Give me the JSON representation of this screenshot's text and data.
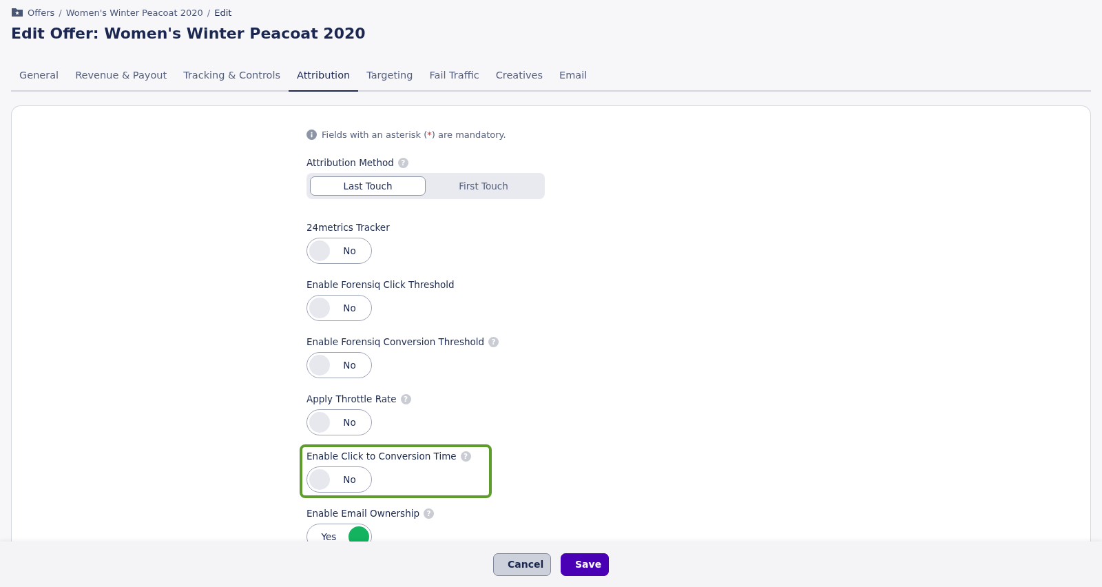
{
  "breadcrumb": {
    "separator": "/",
    "items": [
      "Offers",
      "Women's Winter Peacoat 2020",
      "Edit"
    ]
  },
  "title": "Edit Offer: Women's Winter Peacoat 2020",
  "tabs": [
    {
      "label": "General",
      "selected": false
    },
    {
      "label": "Revenue & Payout",
      "selected": false
    },
    {
      "label": "Tracking & Controls",
      "selected": false
    },
    {
      "label": "Attribution",
      "selected": true
    },
    {
      "label": "Targeting",
      "selected": false
    },
    {
      "label": "Fail Traffic",
      "selected": false
    },
    {
      "label": "Creatives",
      "selected": false
    },
    {
      "label": "Email",
      "selected": false
    }
  ],
  "note": {
    "before": "Fields with an asterisk (",
    "mark": "*",
    "after": ") are mandatory."
  },
  "attribution_method": {
    "label": "Attribution Method",
    "help": "?",
    "options": [
      {
        "label": "Last Touch",
        "selected": true
      },
      {
        "label": "First Touch",
        "selected": false
      }
    ]
  },
  "fields": [
    {
      "label": "24metrics Tracker",
      "on": false,
      "value": "No",
      "highlighted": false
    },
    {
      "label": "Enable Forensiq Click Threshold",
      "on": false,
      "value": "No",
      "highlighted": false
    },
    {
      "label": "Enable Forensiq Conversion Threshold",
      "help": "?",
      "on": false,
      "value": "No",
      "highlighted": false
    },
    {
      "label": "Apply Throttle Rate",
      "help": "?",
      "on": false,
      "value": "No",
      "highlighted": false
    },
    {
      "label": "Enable Click to Conversion Time",
      "help": "?",
      "on": false,
      "value": "No",
      "highlighted": true
    },
    {
      "label": "Enable Email Ownership",
      "help": "?",
      "on": true,
      "value": "Yes",
      "highlighted": false
    }
  ],
  "buttons": [
    {
      "label": "Cancel",
      "kind": "secondary"
    },
    {
      "label": "Save",
      "kind": "primary"
    }
  ]
}
